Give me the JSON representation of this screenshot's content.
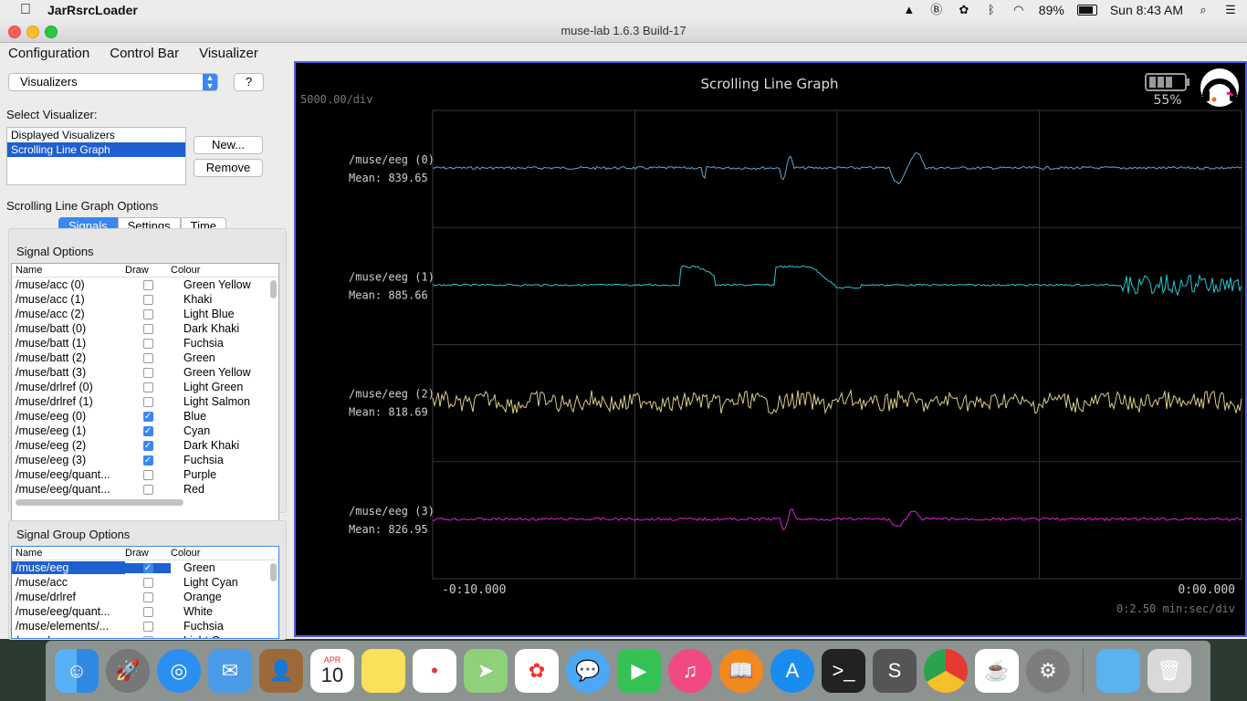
{
  "menubar": {
    "app_name": "JarRsrcLoader",
    "battery_pct": "89%",
    "clock": "Sun 8:43 AM"
  },
  "window": {
    "title": "muse-lab 1.6.3 Build-17",
    "menus": [
      "Configuration",
      "Control Bar",
      "Visualizer"
    ]
  },
  "left": {
    "combo_value": "Visualizers",
    "help_label": "?",
    "select_label": "Select Visualizer:",
    "list_items": [
      "Displayed Visualizers",
      "Scrolling Line Graph"
    ],
    "new_label": "New...",
    "remove_label": "Remove",
    "options_title": "Scrolling Line Graph Options",
    "tabs": [
      "Signals",
      "Settings",
      "Time"
    ],
    "signal_options_title": "Signal Options",
    "signal_group_title": "Signal Group Options",
    "col_name": "Name",
    "col_draw": "Draw",
    "col_colour": "Colour",
    "signals": [
      {
        "name": "/muse/acc (0)",
        "draw": false,
        "colour": "Green Yellow"
      },
      {
        "name": "/muse/acc (1)",
        "draw": false,
        "colour": "Khaki"
      },
      {
        "name": "/muse/acc (2)",
        "draw": false,
        "colour": "Light Blue"
      },
      {
        "name": "/muse/batt (0)",
        "draw": false,
        "colour": "Dark Khaki"
      },
      {
        "name": "/muse/batt (1)",
        "draw": false,
        "colour": "Fuchsia"
      },
      {
        "name": "/muse/batt (2)",
        "draw": false,
        "colour": "Green"
      },
      {
        "name": "/muse/batt (3)",
        "draw": false,
        "colour": "Green Yellow"
      },
      {
        "name": "/muse/drlref (0)",
        "draw": false,
        "colour": "Light Green"
      },
      {
        "name": "/muse/drlref (1)",
        "draw": false,
        "colour": "Light Salmon"
      },
      {
        "name": "/muse/eeg (0)",
        "draw": true,
        "colour": "Blue"
      },
      {
        "name": "/muse/eeg (1)",
        "draw": true,
        "colour": "Cyan"
      },
      {
        "name": "/muse/eeg (2)",
        "draw": true,
        "colour": "Dark Khaki"
      },
      {
        "name": "/muse/eeg (3)",
        "draw": true,
        "colour": "Fuchsia"
      },
      {
        "name": "/muse/eeg/quant...",
        "draw": false,
        "colour": "Purple"
      },
      {
        "name": "/muse/eeg/quant...",
        "draw": false,
        "colour": "Red"
      }
    ],
    "groups": [
      {
        "name": "/muse/eeg",
        "draw": true,
        "colour": "Green",
        "selected": true
      },
      {
        "name": "/muse/acc",
        "draw": false,
        "colour": "Light Cyan"
      },
      {
        "name": "/muse/drlref",
        "draw": false,
        "colour": "Orange"
      },
      {
        "name": "/muse/eeg/quant...",
        "draw": false,
        "colour": "White"
      },
      {
        "name": "/muse/elements/...",
        "draw": false,
        "colour": "Fuchsia"
      },
      {
        "name": "/muse/...",
        "draw": false,
        "colour": "Light Cyan"
      }
    ]
  },
  "graph": {
    "title": "Scrolling Line Graph",
    "y_scale": "5000.00/div",
    "battery": "55%",
    "x_start": "-0:10.000",
    "x_end": "0:00.000",
    "x_scale": "0:2.50 min:sec/div",
    "channels": [
      {
        "name": "/muse/eeg (0)",
        "mean": "Mean: 839.65",
        "color": "#5fa8d8"
      },
      {
        "name": "/muse/eeg (1)",
        "mean": "Mean: 885.66",
        "color": "#27c9d6"
      },
      {
        "name": "/muse/eeg (2)",
        "mean": "Mean: 818.69",
        "color": "#d8cf86"
      },
      {
        "name": "/muse/eeg (3)",
        "mean": "Mean: 826.95",
        "color": "#e020d8"
      }
    ]
  },
  "dock": {
    "calendar_month": "APR",
    "calendar_day": "10",
    "icons": [
      "finder-icon",
      "launchpad-icon",
      "safari-icon",
      "mail-icon",
      "contacts-icon",
      "calendar-icon",
      "notes-icon",
      "reminders-icon",
      "maps-icon",
      "photos-icon",
      "messages-icon",
      "facetime-icon",
      "itunes-icon",
      "ibooks-icon",
      "appstore-icon",
      "terminal-icon",
      "sublime-icon",
      "chrome-icon",
      "java-icon",
      "system-preferences-icon",
      "downloads-folder-icon",
      "trash-icon"
    ]
  }
}
